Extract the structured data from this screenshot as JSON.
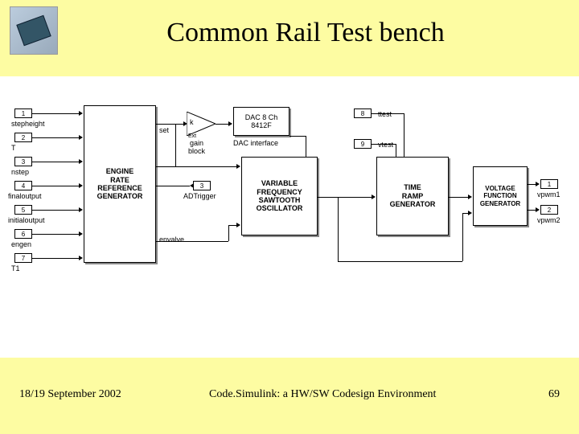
{
  "header": {
    "title": "Common Rail Test bench"
  },
  "footer": {
    "date": "18/19 September 2002",
    "caption": "Code.Simulink: a HW/SW Codesign Environment",
    "page": "69"
  },
  "ports_in": [
    {
      "n": "1",
      "label": "stepheight"
    },
    {
      "n": "2",
      "label": "T"
    },
    {
      "n": "3",
      "label": "nstep"
    },
    {
      "n": "4",
      "label": "finaloutput"
    },
    {
      "n": "5",
      "label": "initialoutput"
    },
    {
      "n": "6",
      "label": "engen"
    },
    {
      "n": "7",
      "label": "T1"
    }
  ],
  "mid_ports": [
    {
      "n": "3",
      "label": "ADTrigger"
    },
    {
      "n": "8",
      "label": "ttest"
    },
    {
      "n": "9",
      "label": "vtest"
    }
  ],
  "ports_out": [
    {
      "n": "1",
      "label": "vpwm1"
    },
    {
      "n": "2",
      "label": "vpwm2"
    }
  ],
  "blocks": {
    "engine": "ENGINE\nRATE\nREFERENCE\nGENERATOR",
    "engine_out_set": "set",
    "engine_out_env": "envalve",
    "gain": "k",
    "gain_label": "gain\nblock",
    "dac": "DAC 8 Ch\n8412F",
    "dac_label": "DAC interface",
    "vfso": "VARIABLE\nFREQUENCY\nSAWTOOTH\nOSCILLATOR",
    "ramp": "TIME\nRAMP\nGENERATOR",
    "vfg": "VOLTAGE\nFUNCTION\nGENERATOR"
  }
}
